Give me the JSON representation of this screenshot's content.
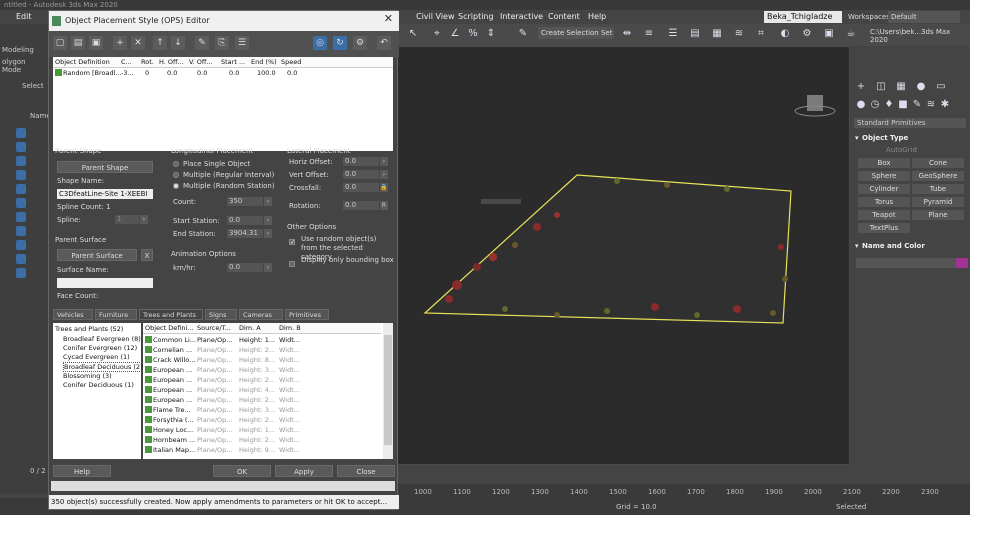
{
  "app": {
    "title": "ntitled - Autodesk 3ds Max 2020",
    "menus": [
      "Edit",
      "Civil View",
      "Scripting",
      "Interactive",
      "Content",
      "Help"
    ],
    "user": "Beka_Tchigladze",
    "workspaces_label": "Workspaces:",
    "workspace_value": "Default",
    "selection_set": "Create Selection Set",
    "path": "C:\\Users\\bek...3ds Max 2020",
    "left_tabs": [
      "Modeling",
      "olygon Mode",
      "Select"
    ],
    "name_header": "Name",
    "frames": "0 / 2"
  },
  "right_panel": {
    "dropdown": "Standard Primitives",
    "object_type_title": "Object Type",
    "autogrid": "AutoGrid",
    "buttons": [
      "Box",
      "Cone",
      "Sphere",
      "GeoSphere",
      "Cylinder",
      "Tube",
      "Torus",
      "Pyramid",
      "Teapot",
      "Plane",
      "TextPlus"
    ],
    "name_color_title": "Name and Color"
  },
  "timeline": {
    "ticks": [
      "1000",
      "1100",
      "1200",
      "1300",
      "1400",
      "1500",
      "1600",
      "1700",
      "1800",
      "1900",
      "2000",
      "2100",
      "2200",
      "2300"
    ]
  },
  "statusbar": {
    "grid": "Grid = 10.0",
    "selected": "Selected"
  },
  "dialog": {
    "title": "Object Placement Style (OPS) Editor",
    "table_headers": [
      "Object Definition",
      "C...",
      "Rot.",
      "H. Off...",
      "V. Off...",
      "Start ...",
      "End (%)",
      "Speed"
    ],
    "table_row": [
      "Random [Broadl...",
      "-3...",
      "0",
      "0.0",
      "0.0",
      "0.0",
      "100.0",
      "0.0"
    ],
    "parent_shape": {
      "title": "Parent Shape",
      "button": "Parent Shape",
      "shape_name_label": "Shape Name:",
      "shape_name_value": "C3DfeatLine-Site 1-XEEBI",
      "spline_count": "Spline Count: 1",
      "spline_label": "Spline:",
      "spline_value": "1"
    },
    "parent_surface": {
      "title": "Parent Surface",
      "button": "Parent Surface",
      "clear": "X",
      "surface_name_label": "Surface Name:",
      "face_count": "Face Count:"
    },
    "longitudinal": {
      "title": "Longitudinal Placement",
      "opt1": "Place Single Object",
      "opt2": "Multiple (Regular Interval)",
      "opt3": "Multiple (Random Station)",
      "count_label": "Count:",
      "count_value": "350",
      "start_label": "Start Station:",
      "start_value": "0.0",
      "end_label": "End Station:",
      "end_value": "3904.31"
    },
    "animation": {
      "title": "Animation Options",
      "kmh_label": "km/hr:",
      "kmh_value": "0.0"
    },
    "lateral": {
      "title": "Lateral Placement",
      "horiz_label": "Horiz Offset:",
      "horiz_value": "0.0",
      "vert_label": "Vert Offset:",
      "vert_value": "0.0",
      "cross_label": "Crossfall:",
      "cross_value": "0.0",
      "rot_label": "Rotation:",
      "rot_value": "0.0"
    },
    "other": {
      "title": "Other Options",
      "opt1": "Use random object(s) from the selected category",
      "opt2": "Display only bounding box"
    },
    "tabs": [
      "Vehicles",
      "Furniture",
      "Trees and Plants",
      "Signs",
      "Cameras",
      "Primitives"
    ],
    "categories": [
      "Trees and Plants (52)",
      "Broadleaf Evergreen (8)",
      "Conifer Evergreen (12)",
      "Cycad Evergreen (1)",
      "Broadleaf Deciduous (27)",
      "Blossoming (3)",
      "Conifer Deciduous (1)"
    ],
    "obj_headers": [
      "Object Defini...",
      "Source/T...",
      "Dim. A",
      "Dim. B"
    ],
    "objects": [
      [
        "Common Li...",
        "Plane/Op...",
        "Height: 1...",
        "Widt..."
      ],
      [
        "Cornelian ...",
        "Plane/Op...",
        "Height: 2...",
        "Widt..."
      ],
      [
        "Crack Willo...",
        "Plane/Op...",
        "Height: 8...",
        "Widt..."
      ],
      [
        "European ...",
        "Plane/Op...",
        "Height: 3...",
        "Widt..."
      ],
      [
        "European ...",
        "Plane/Op...",
        "Height: 2...",
        "Widt..."
      ],
      [
        "European ...",
        "Plane/Op...",
        "Height: 4...",
        "Widt..."
      ],
      [
        "European ...",
        "Plane/Op...",
        "Height: 2...",
        "Widt..."
      ],
      [
        "Flame Tre...",
        "Plane/Op...",
        "Height: 3...",
        "Widt..."
      ],
      [
        "Forsythia (...",
        "Plane/Op...",
        "Height: 2...",
        "Widt..."
      ],
      [
        "Honey Loc...",
        "Plane/Op...",
        "Height: 1...",
        "Widt..."
      ],
      [
        "Hornbeam ...",
        "Plane/Op...",
        "Height: 2...",
        "Widt..."
      ],
      [
        "Italian Map...",
        "Plane/Op...",
        "Height: 9...",
        "Widt..."
      ]
    ],
    "help": "Help",
    "ok": "OK",
    "apply": "Apply",
    "close": "Close",
    "status": "350 object(s) successfully created. Now apply amendments to parameters or hit OK to accept..."
  }
}
